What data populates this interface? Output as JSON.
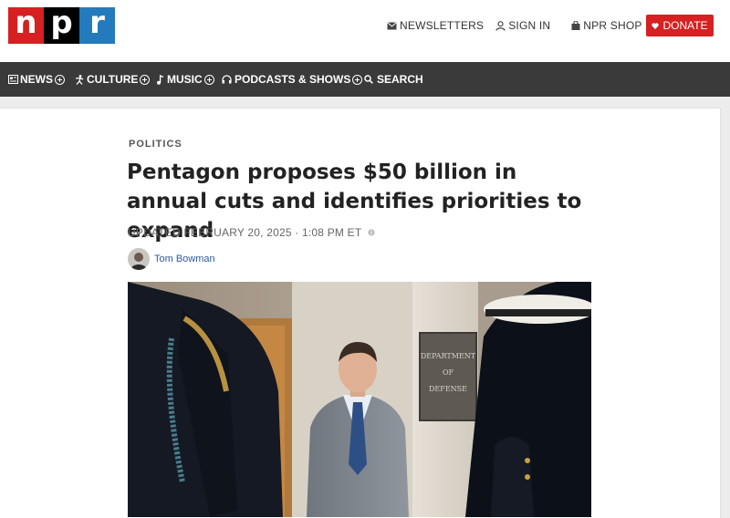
{
  "logo": {
    "letters": [
      "n",
      "p",
      "r"
    ],
    "colors": [
      "#d62021",
      "#000000",
      "#237bbd"
    ]
  },
  "header": {
    "newsletters": {
      "label": "NEWSLETTERS",
      "icon": "envelope-icon"
    },
    "sign_in": {
      "label": "SIGN IN",
      "icon": "person-icon"
    },
    "shop": {
      "label": "NPR SHOP",
      "icon": "shopping-bag-icon"
    },
    "donate": {
      "label": "DONATE",
      "icon": "heart-icon",
      "color": "#d62021"
    }
  },
  "nav": {
    "items": [
      {
        "label": "NEWS",
        "icon": "newspaper-icon"
      },
      {
        "label": "CULTURE",
        "icon": "figure-icon"
      },
      {
        "label": "MUSIC",
        "icon": "music-note-icon"
      },
      {
        "label": "PODCASTS & SHOWS",
        "icon": "headphones-icon"
      },
      {
        "label": "SEARCH",
        "icon": "search-icon"
      }
    ]
  },
  "article": {
    "section": "POLITICS",
    "headline": "Pentagon proposes $50 billion in annual cuts and identifies priorities to expand",
    "dateline": "UPDATED FEBRUARY 20, 2025 · 1:08 PM ET",
    "author": "Tom Bowman",
    "photo_sign": [
      "DEPARTMENT",
      "OF",
      "DEFENSE"
    ]
  }
}
